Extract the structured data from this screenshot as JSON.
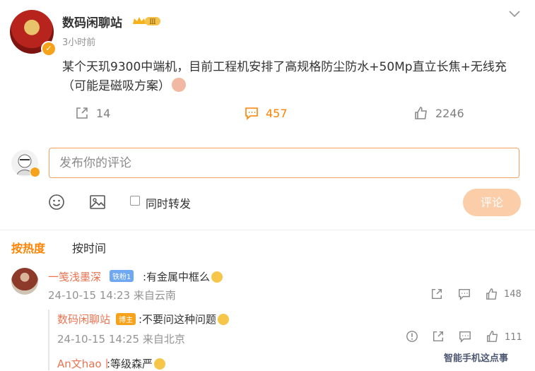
{
  "post": {
    "author": "数码闲聊站",
    "badge": "Ⅲ",
    "time": "3小时前",
    "content": "某个天玑9300中端机，目前工程机安排了高规格防尘防水+50Mp直立长焦+无线充（可能是磁吸方案）",
    "reposts": "14",
    "comments": "457",
    "likes": "2246"
  },
  "composer": {
    "placeholder": "发布你的评论",
    "repost_label": "同时转发",
    "submit_label": "评论"
  },
  "sort": {
    "hot": "按热度",
    "time": "按时间"
  },
  "comments": [
    {
      "user": "一笺浅墨深",
      "fan_badge": "铁粉1",
      "text": ":有金属中框么",
      "meta": "24-10-15 14:23 来自云南",
      "likes": "148",
      "replies": [
        {
          "user": "数码闲聊站",
          "tag": "博主",
          "text": ":不要问这种问题",
          "meta": "24-10-15 14:25 来自北京",
          "likes": "111"
        },
        {
          "user": "An文hao丨",
          "text": ":等级森严"
        }
      ]
    }
  ],
  "watermark": "智能手机这点事",
  "colors": {
    "accent": "#ff8200",
    "link": "#eb7350",
    "submit_disabled": "#fbcda8"
  }
}
